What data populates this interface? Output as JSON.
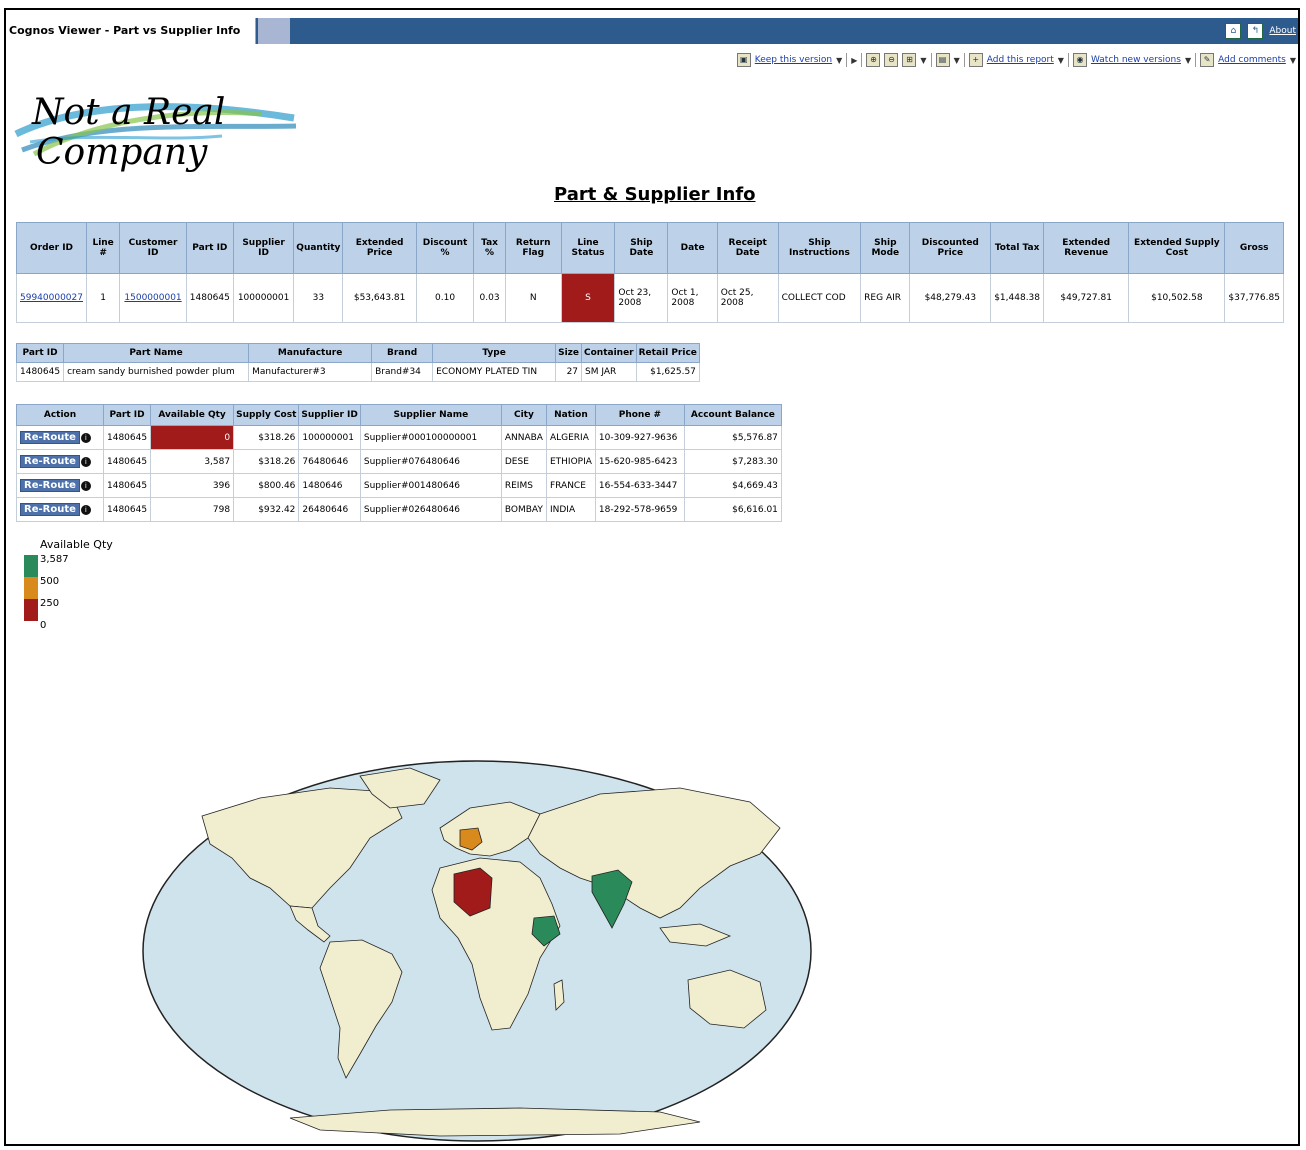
{
  "window": {
    "tab_title": "Cognos Viewer - Part vs Supplier Info",
    "about_label": "About"
  },
  "toolbar": {
    "keep_version": "Keep this version",
    "add_report": "Add this report",
    "watch_versions": "Watch new versions",
    "add_comments": "Add comments"
  },
  "logo": {
    "line1": "Not a Real",
    "line2": "Company"
  },
  "report_title": "Part & Supplier Info",
  "order_table": {
    "headers": [
      "Order ID",
      "Line #",
      "Customer ID",
      "Part ID",
      "Supplier ID",
      "Quantity",
      "Extended Price",
      "Discount %",
      "Tax %",
      "Return Flag",
      "Line Status",
      "Ship Date",
      "Date",
      "Receipt Date",
      "Ship Instructions",
      "Ship Mode",
      "Discounted Price",
      "Total Tax",
      "Extended Revenue",
      "Extended Supply Cost",
      "Gross"
    ],
    "row": {
      "order_id": "59940000027",
      "line": "1",
      "customer_id": "1500000001",
      "part_id": "1480645",
      "supplier_id": "100000001",
      "quantity": "33",
      "extended_price": "$53,643.81",
      "discount": "0.10",
      "tax": "0.03",
      "return_flag": "N",
      "line_status": "S",
      "ship_date": "Oct 23, 2008",
      "date": "Oct 1, 2008",
      "receipt_date": "Oct 25, 2008",
      "ship_instructions": "COLLECT COD",
      "ship_mode": "REG AIR",
      "discounted_price": "$48,279.43",
      "total_tax": "$1,448.38",
      "extended_revenue": "$49,727.81",
      "extended_supply_cost": "$10,502.58",
      "gross": "$37,776.85"
    }
  },
  "part_table": {
    "headers": [
      "Part ID",
      "Part Name",
      "Manufacture",
      "Brand",
      "Type",
      "Size",
      "Container",
      "Retail Price"
    ],
    "row": [
      "1480645",
      "cream sandy burnished powder plum",
      "Manufacturer#3",
      "Brand#34",
      "ECONOMY PLATED TIN",
      "27",
      "SM JAR",
      "$1,625.57"
    ]
  },
  "supplier_table": {
    "headers": [
      "Action",
      "Part ID",
      "Available Qty",
      "Supply Cost",
      "Supplier ID",
      "Supplier Name",
      "City",
      "Nation",
      "Phone #",
      "Account Balance"
    ],
    "action_label": "Re-Route",
    "rows": [
      [
        "1480645",
        "0",
        "$318.26",
        "100000001",
        "Supplier#000100000001",
        "ANNABA",
        "ALGERIA",
        "10-309-927-9636",
        "$5,576.87"
      ],
      [
        "1480645",
        "3,587",
        "$318.26",
        "76480646",
        "Supplier#076480646",
        "DESE",
        "ETHIOPIA",
        "15-620-985-6423",
        "$7,283.30"
      ],
      [
        "1480645",
        "396",
        "$800.46",
        "1480646",
        "Supplier#001480646",
        "REIMS",
        "FRANCE",
        "16-554-633-3447",
        "$4,669.43"
      ],
      [
        "1480645",
        "798",
        "$932.42",
        "26480646",
        "Supplier#026480646",
        "BOMBAY",
        "INDIA",
        "18-292-578-9659",
        "$6,616.01"
      ]
    ]
  },
  "legend": {
    "title": "Available Qty",
    "items": [
      {
        "label": "3,587",
        "color": "#2a8a5a"
      },
      {
        "label": "500",
        "color": "#d88a1c"
      },
      {
        "label": "250",
        "color": "#a11b1b"
      },
      {
        "label": "0",
        "color": ""
      }
    ]
  },
  "map": {
    "ocean_color": "#cfe3ec",
    "land_color": "#f1edcf",
    "highlight": {
      "algeria": "#a11b1b",
      "france": "#d88a1c",
      "ethiopia": "#2a8a5a",
      "india": "#2a8a5a"
    }
  }
}
